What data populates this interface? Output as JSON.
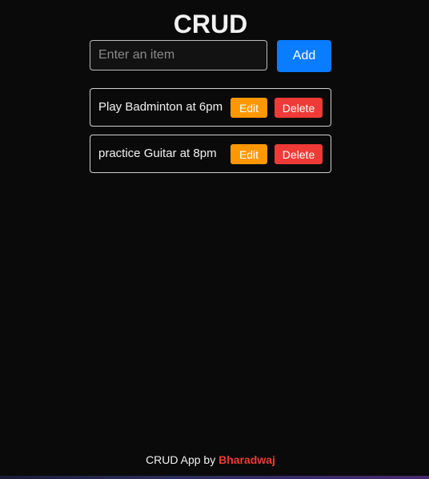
{
  "header": {
    "title": "CRUD"
  },
  "form": {
    "input_value": "",
    "input_placeholder": "Enter an item",
    "add_label": "Add"
  },
  "items": [
    {
      "text": "Play Badminton at 6pm",
      "edit_label": "Edit",
      "delete_label": "Delete"
    },
    {
      "text": "practice Guitar at 8pm",
      "edit_label": "Edit",
      "delete_label": "Delete"
    }
  ],
  "footer": {
    "prefix": "CRUD App by ",
    "author": "Bharadwaj"
  },
  "colors": {
    "background": "#0a0a0a",
    "add_button": "#0a7cff",
    "edit_button": "#ff9800",
    "delete_button": "#ee3b37",
    "author": "#ee3b37"
  }
}
